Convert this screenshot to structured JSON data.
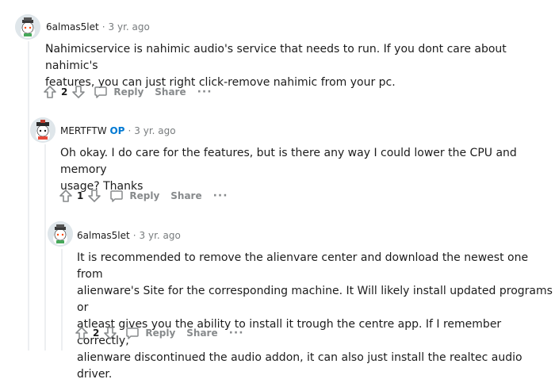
{
  "comments": [
    {
      "username": "6almas5let",
      "is_op": false,
      "op_label": "",
      "time": "3 yr. ago",
      "body": "Nahimicservice is nahimic audio's service that needs to run. If you dont care about nahimic's\nfeatures, you can just right click-remove nahimic from your pc.",
      "score": "2",
      "reply_label": "Reply",
      "share_label": "Share",
      "more_label": "···"
    },
    {
      "username": "MERTFTW",
      "is_op": true,
      "op_label": "OP",
      "time": "3 yr. ago",
      "body": "Oh okay. I do care for the features, but is there any way I could lower the CPU and memory\nusage? Thanks",
      "score": "1",
      "reply_label": "Reply",
      "share_label": "Share",
      "more_label": "···"
    },
    {
      "username": "6almas5let",
      "is_op": false,
      "op_label": "",
      "time": "3 yr. ago",
      "body": "It is recommended to remove the alienvare center and download the newest one from\nalienware's Site for the corresponding machine. It Will likely install updated programs or\natleast gives you the ability to install it trough the centre app. If I remember correctly,\nalienware discontinued the audio addon, it can also just install the realtec audio driver.",
      "score": "2",
      "reply_label": "Reply",
      "share_label": "Share",
      "more_label": "···"
    }
  ],
  "separator": "·"
}
